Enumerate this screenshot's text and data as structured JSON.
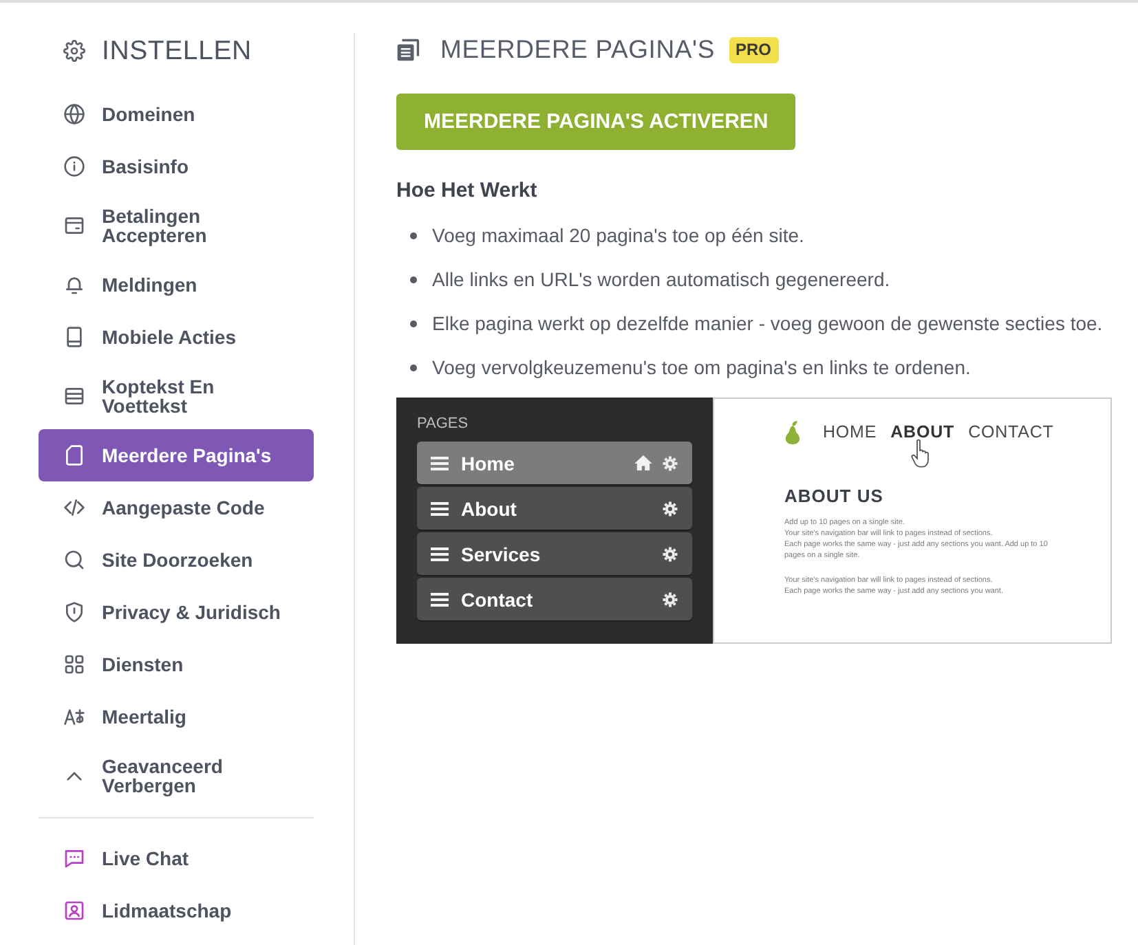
{
  "sidebar": {
    "title": "INSTELLEN",
    "items": [
      {
        "label": "Domeinen",
        "selected": false
      },
      {
        "label": "Basisinfo",
        "selected": false
      },
      {
        "label": "Betalingen Accepteren",
        "selected": false
      },
      {
        "label": "Meldingen",
        "selected": false
      },
      {
        "label": "Mobiele Acties",
        "selected": false
      },
      {
        "label": "Koptekst En Voettekst",
        "selected": false
      },
      {
        "label": "Meerdere Pagina's",
        "selected": true
      },
      {
        "label": "Aangepaste Code",
        "selected": false
      },
      {
        "label": "Site Doorzoeken",
        "selected": false
      },
      {
        "label": "Privacy & Juridisch",
        "selected": false
      },
      {
        "label": "Diensten",
        "selected": false
      },
      {
        "label": "Meertalig",
        "selected": false
      }
    ],
    "advanced_toggle": {
      "label": "Geavanceerd Verbergen",
      "expanded": true
    },
    "extra_items": [
      {
        "label": "Live Chat"
      },
      {
        "label": "Lidmaatschap"
      }
    ]
  },
  "main": {
    "title": "MEERDERE PAGINA'S",
    "badge": "PRO",
    "activate_button": "MEERDERE PAGINA'S ACTIVEREN",
    "how_it_works": {
      "title": "Hoe Het Werkt",
      "bullets": [
        "Voeg maximaal 20 pagina's toe op één site.",
        "Alle links en URL's worden automatisch gegenereerd.",
        "Elke pagina werkt op dezelfde manier - voeg gewoon de gewenste secties toe.",
        "Voeg vervolgkeuzemenu's toe om pagina's en links te ordenen."
      ]
    },
    "inset": {
      "pages_title": "PAGES",
      "pages": [
        {
          "label": "Home",
          "selected": true,
          "home": true
        },
        {
          "label": "About",
          "selected": false,
          "home": false
        },
        {
          "label": "Services",
          "selected": false,
          "home": false
        },
        {
          "label": "Contact",
          "selected": false,
          "home": false
        }
      ],
      "nav": [
        {
          "label": "HOME",
          "selected": false
        },
        {
          "label": "ABOUT",
          "selected": true
        },
        {
          "label": "CONTACT",
          "selected": false
        }
      ],
      "heading": "ABOUT US",
      "paragraphs": [
        [
          "Add up to 10 pages on a single site.",
          "Your site's navigation bar will link to pages instead of sections.",
          "Each page works the same way - just add any sections you want. Add up to 10 pages on a single site."
        ],
        [
          "Your site's navigation bar will link to pages instead of sections.",
          "Each page works the same way - just add any sections you want."
        ]
      ]
    }
  }
}
